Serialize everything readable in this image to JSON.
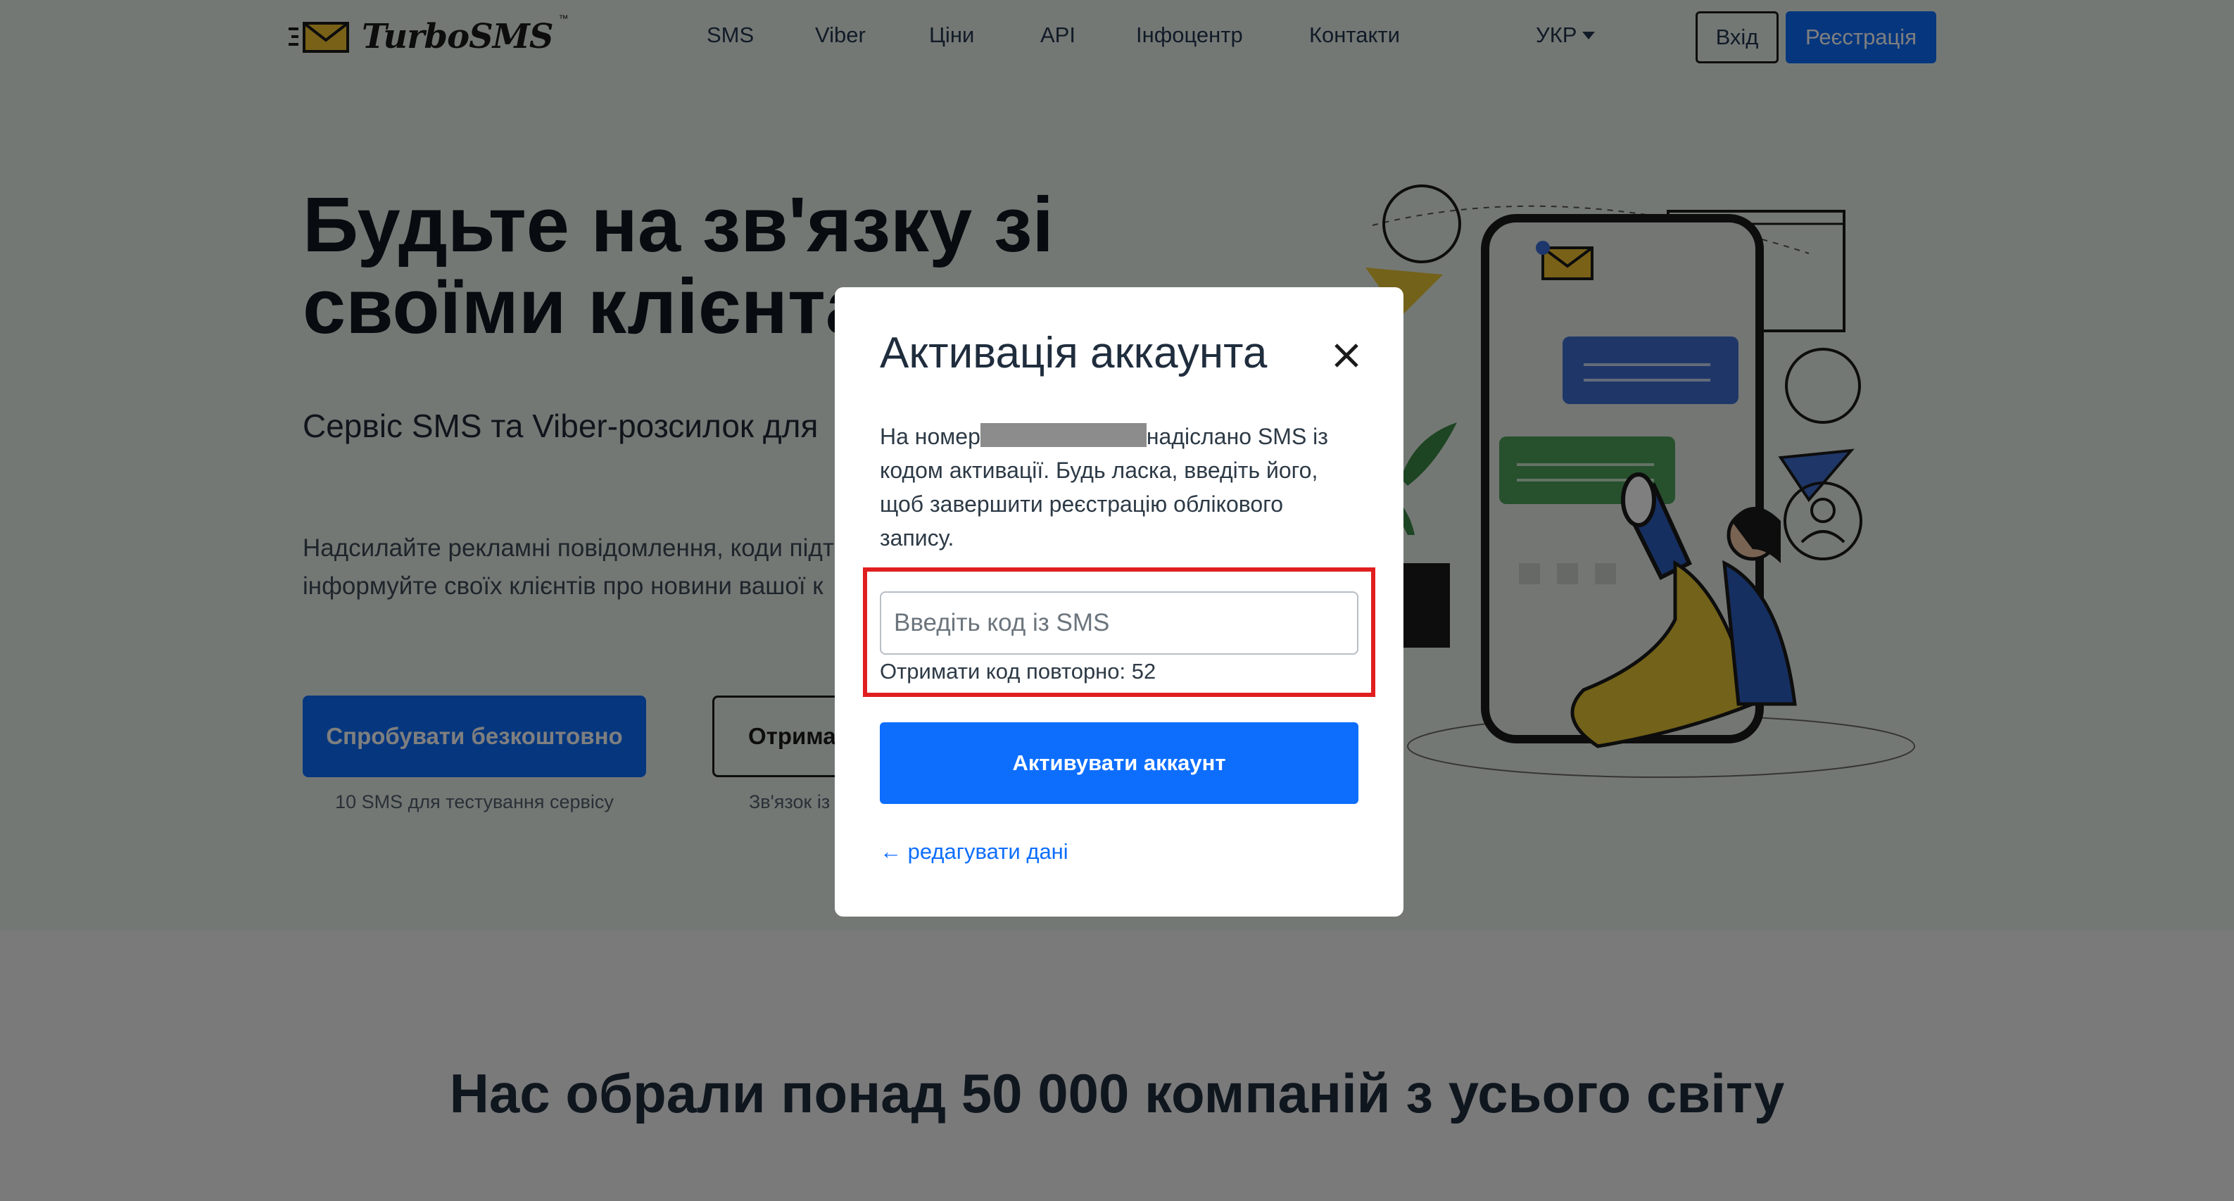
{
  "header": {
    "logo_text": "TurboSMS",
    "logo_tm": "™",
    "nav": [
      "SMS",
      "Viber",
      "Ціни",
      "API",
      "Інфоцентр",
      "Контакти"
    ],
    "language": "УКР",
    "login_label": "Вхід",
    "register_label": "Реєстрація"
  },
  "hero": {
    "title_line1": "Будьте на зв'язку зі",
    "title_line2": "своїми клієнта",
    "subtitle": "Сервіс SMS та Viber-розсилок для",
    "desc_line1": "Надсилайте рекламні повідомлення, коди підт",
    "desc_line2": "інформуйте своїх клієнтів про новини вашої к",
    "try_button": "Спробувати безкоштовно",
    "try_note": "10 SMS для тестування сервісу",
    "get_button": "Отримат",
    "get_note": "Зв'язок із"
  },
  "lower": {
    "title": "Нас обрали понад 50 000 компаній з усього світу"
  },
  "modal": {
    "title": "Активація аккаунта",
    "text_before": "На номер",
    "text_after": "надіслано SMS із кодом активації. Будь ласка, введіть його, щоб завершити реєстрацію облікового запису.",
    "input_placeholder": "Введіть код із SMS",
    "input_value": "",
    "resend_text": "Отримати код повторно: 52",
    "activate_button": "Активувати аккаунт",
    "edit_link": "← редагувати дані"
  },
  "colors": {
    "accent": "#0d6efd",
    "highlight_border": "#e01e1e",
    "hero_background": "#e8f1ea"
  }
}
